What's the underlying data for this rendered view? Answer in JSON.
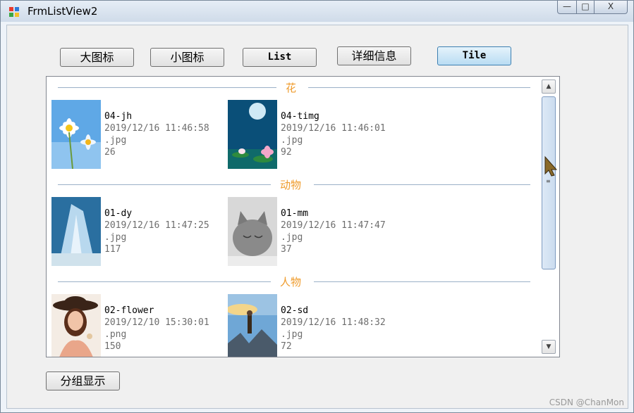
{
  "window": {
    "title": "FrmListView2",
    "min_glyph": "—",
    "max_glyph": "□",
    "close_glyph": "X"
  },
  "toolbar": {
    "large_icon_label": "大图标",
    "small_icon_label": "小图标",
    "list_label": "List",
    "details_label": "详细信息",
    "tile_label": "Tile"
  },
  "listview": {
    "groups": [
      {
        "name": "花",
        "items": [
          {
            "name": "04-jh",
            "date": "2019/12/16 11:46:58",
            "ext": ".jpg",
            "size": "26"
          },
          {
            "name": "04-timg",
            "date": "2019/12/16 11:46:01",
            "ext": ".jpg",
            "size": "92"
          }
        ]
      },
      {
        "name": "动物",
        "items": [
          {
            "name": "01-dy",
            "date": "2019/12/16 11:47:25",
            "ext": ".jpg",
            "size": "117"
          },
          {
            "name": "01-mm",
            "date": "2019/12/16 11:47:47",
            "ext": ".jpg",
            "size": "37"
          }
        ]
      },
      {
        "name": "人物",
        "items": [
          {
            "name": "02-flower",
            "date": "2019/12/10 15:30:01",
            "ext": ".png",
            "size": "150"
          },
          {
            "name": "02-sd",
            "date": "2019/12/16 11:48:32",
            "ext": ".jpg",
            "size": "72"
          }
        ]
      }
    ]
  },
  "group_toggle_label": "分组显示",
  "watermark": "CSDN @ChanMon",
  "colors": {
    "group_header": "#ef9b2b",
    "tile_active": "#b9dcf3"
  }
}
